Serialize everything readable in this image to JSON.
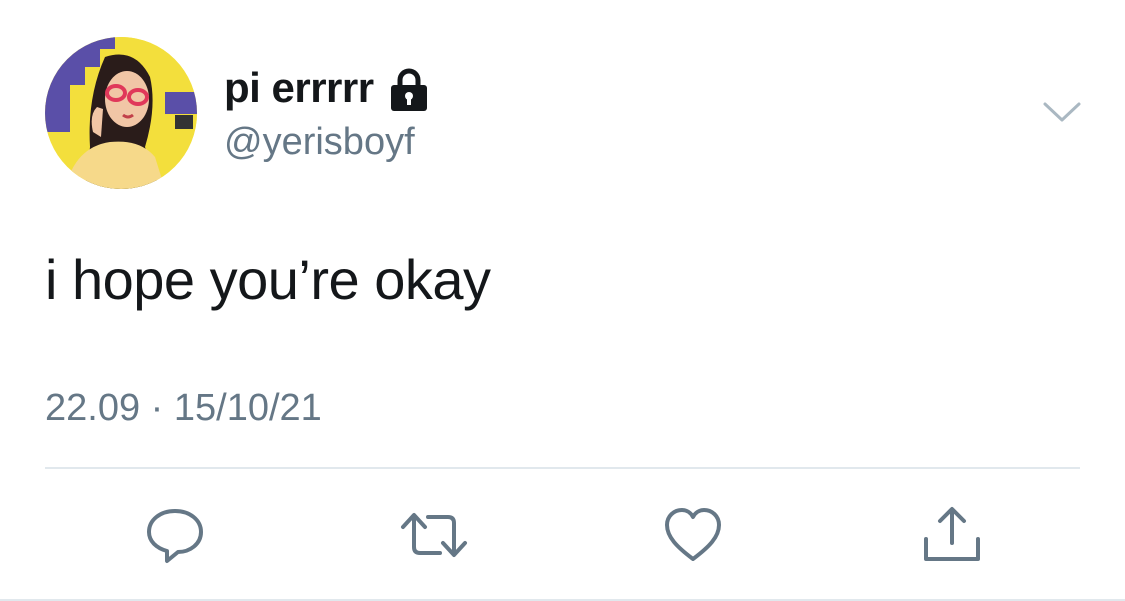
{
  "tweet": {
    "display_name": "pi errrrr",
    "handle": "@yerisboyf",
    "text": "i hope you’re okay",
    "timestamp": "22.09 · 15/10/21",
    "protected": true
  },
  "icons": {
    "lock": "lock-icon",
    "menu": "chevron-down-icon",
    "reply": "reply-icon",
    "retweet": "retweet-icon",
    "like": "heart-icon",
    "share": "share-icon"
  },
  "colors": {
    "primary_text": "#14171a",
    "secondary_text": "#657786",
    "divider": "#e1e8ed",
    "icon": "#657786"
  }
}
